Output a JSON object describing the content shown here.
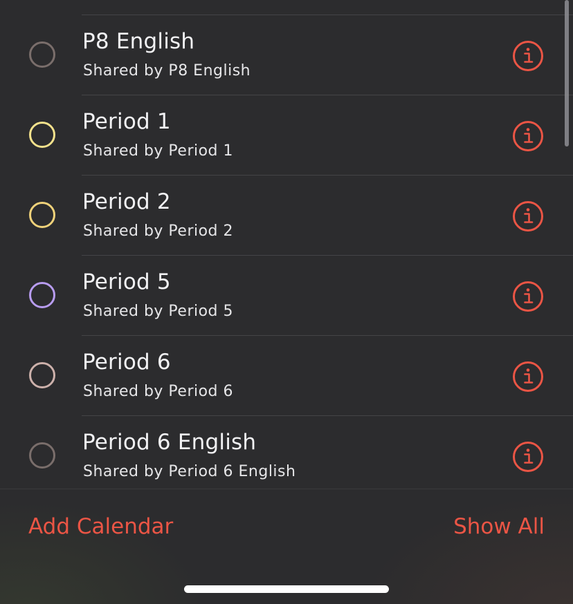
{
  "calendars": [
    {
      "name": "P8 English",
      "shared_by": "Shared by P8 English",
      "color": "#7a6e6b"
    },
    {
      "name": "Period 1",
      "shared_by": "Shared by Period 1",
      "color": "#f5e28c"
    },
    {
      "name": "Period 2",
      "shared_by": "Shared by Period 2",
      "color": "#f0d27a"
    },
    {
      "name": "Period 5",
      "shared_by": "Shared by Period 5",
      "color": "#b89cf0"
    },
    {
      "name": "Period 6",
      "shared_by": "Shared by Period 6",
      "color": "#cdb1ab"
    },
    {
      "name": "Period 6 English",
      "shared_by": "Shared by Period 6 English",
      "color": "#7a6e6b"
    }
  ],
  "footer": {
    "add_calendar_label": "Add Calendar",
    "show_all_label": "Show All"
  },
  "colors": {
    "accent": "#eb5545",
    "background": "#2c2c2e"
  },
  "icons": {
    "info": "info-circle-icon"
  }
}
